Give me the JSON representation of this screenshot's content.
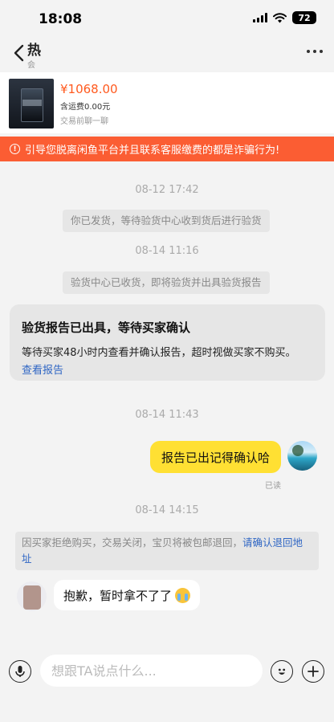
{
  "status_bar": {
    "time": "18:08",
    "battery": "72"
  },
  "nav": {
    "title": "热",
    "subtitle": "会"
  },
  "product": {
    "price": "¥1068.00",
    "shipping": "含运费0.00元",
    "pre_chat": "交易前聊一聊"
  },
  "warning": {
    "icon": "!",
    "text": "引导您脱离闲鱼平台并且联系客服缴费的都是诈骗行为!"
  },
  "messages": {
    "ts1": "08-12 17:42",
    "sys1": "你已发货，等待验货中心收到货后进行验货",
    "ts2": "08-14 11:16",
    "sys2": "验货中心已收货，即将验货并出具验货报告",
    "report": {
      "title": "验货报告已出具，等待买家确认",
      "desc": "等待买家48小时内查看并确认报告，超时视做买家不购买。",
      "link": "查看报告"
    },
    "ts3": "08-14 11:43",
    "mine": "报告已出记得确认哈",
    "read": "已读",
    "ts4": "08-14 14:15",
    "refusal": "因买家拒绝购买，交易关闭，宝贝将被包邮退回，",
    "refusal_link": "请确认退回地址",
    "other": "抱歉，暂时拿不了了"
  },
  "input": {
    "placeholder": "想跟TA说点什么..."
  }
}
